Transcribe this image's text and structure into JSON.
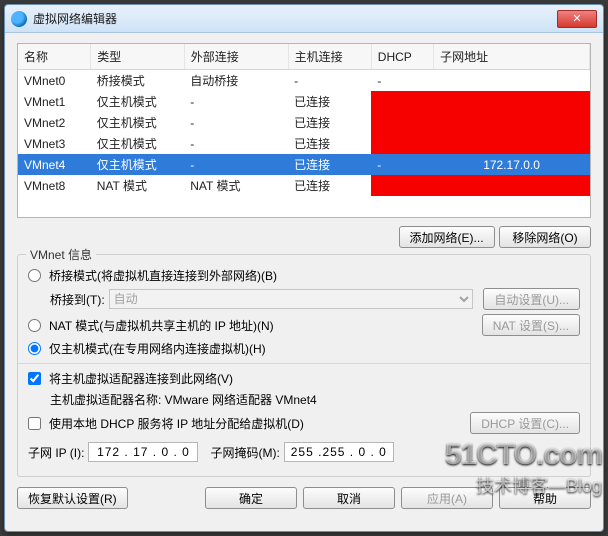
{
  "title": "虚拟网络编辑器",
  "columns": [
    "名称",
    "类型",
    "外部连接",
    "主机连接",
    "DHCP",
    "子网地址"
  ],
  "rows": [
    {
      "name": "VMnet0",
      "type": "桥接模式",
      "ext": "自动桥接",
      "host": "-",
      "dhcp": "-",
      "subnet": "",
      "red": false,
      "sel": false
    },
    {
      "name": "VMnet1",
      "type": "仅主机模式",
      "ext": "-",
      "host": "已连接",
      "dhcp": "",
      "subnet": "",
      "red": true,
      "sel": false
    },
    {
      "name": "VMnet2",
      "type": "仅主机模式",
      "ext": "-",
      "host": "已连接",
      "dhcp": "",
      "subnet": "",
      "red": true,
      "sel": false
    },
    {
      "name": "VMnet3",
      "type": "仅主机模式",
      "ext": "-",
      "host": "已连接",
      "dhcp": "",
      "subnet": "",
      "red": true,
      "sel": false
    },
    {
      "name": "VMnet4",
      "type": "仅主机模式",
      "ext": "-",
      "host": "已连接",
      "dhcp": "-",
      "subnet": "172.17.0.0",
      "red": false,
      "sel": true
    },
    {
      "name": "VMnet8",
      "type": "NAT 模式",
      "ext": "NAT 模式",
      "host": "已连接",
      "dhcp": "",
      "subnet": "",
      "red": true,
      "sel": false
    }
  ],
  "buttons": {
    "add_net": "添加网络(E)...",
    "remove_net": "移除网络(O)",
    "auto_set": "自动设置(U)...",
    "nat_set": "NAT 设置(S)...",
    "dhcp_set": "DHCP 设置(C)...",
    "restore": "恢复默认设置(R)",
    "ok": "确定",
    "cancel": "取消",
    "apply": "应用(A)",
    "help": "帮助"
  },
  "group_title": "VMnet 信息",
  "radio_bridge": "桥接模式(将虚拟机直接连接到外部网络)(B)",
  "bridge_to_label": "桥接到(T):",
  "bridge_to_value": "自动",
  "radio_nat": "NAT 模式(与虚拟机共享主机的 IP 地址)(N)",
  "radio_host": "仅主机模式(在专用网络内连接虚拟机)(H)",
  "chk_connect": "将主机虚拟适配器连接到此网络(V)",
  "adapter_label": "主机虚拟适配器名称: VMware 网络适配器 VMnet4",
  "chk_dhcp": "使用本地 DHCP 服务将 IP 地址分配给虚拟机(D)",
  "subnet_ip_label": "子网 IP (I):",
  "subnet_ip_value": "172 . 17 . 0 . 0",
  "mask_label": "子网掩码(M):",
  "mask_value": "255 .255 . 0 . 0",
  "watermark1": "51CTO.com",
  "watermark2": "技术博客—Blog"
}
